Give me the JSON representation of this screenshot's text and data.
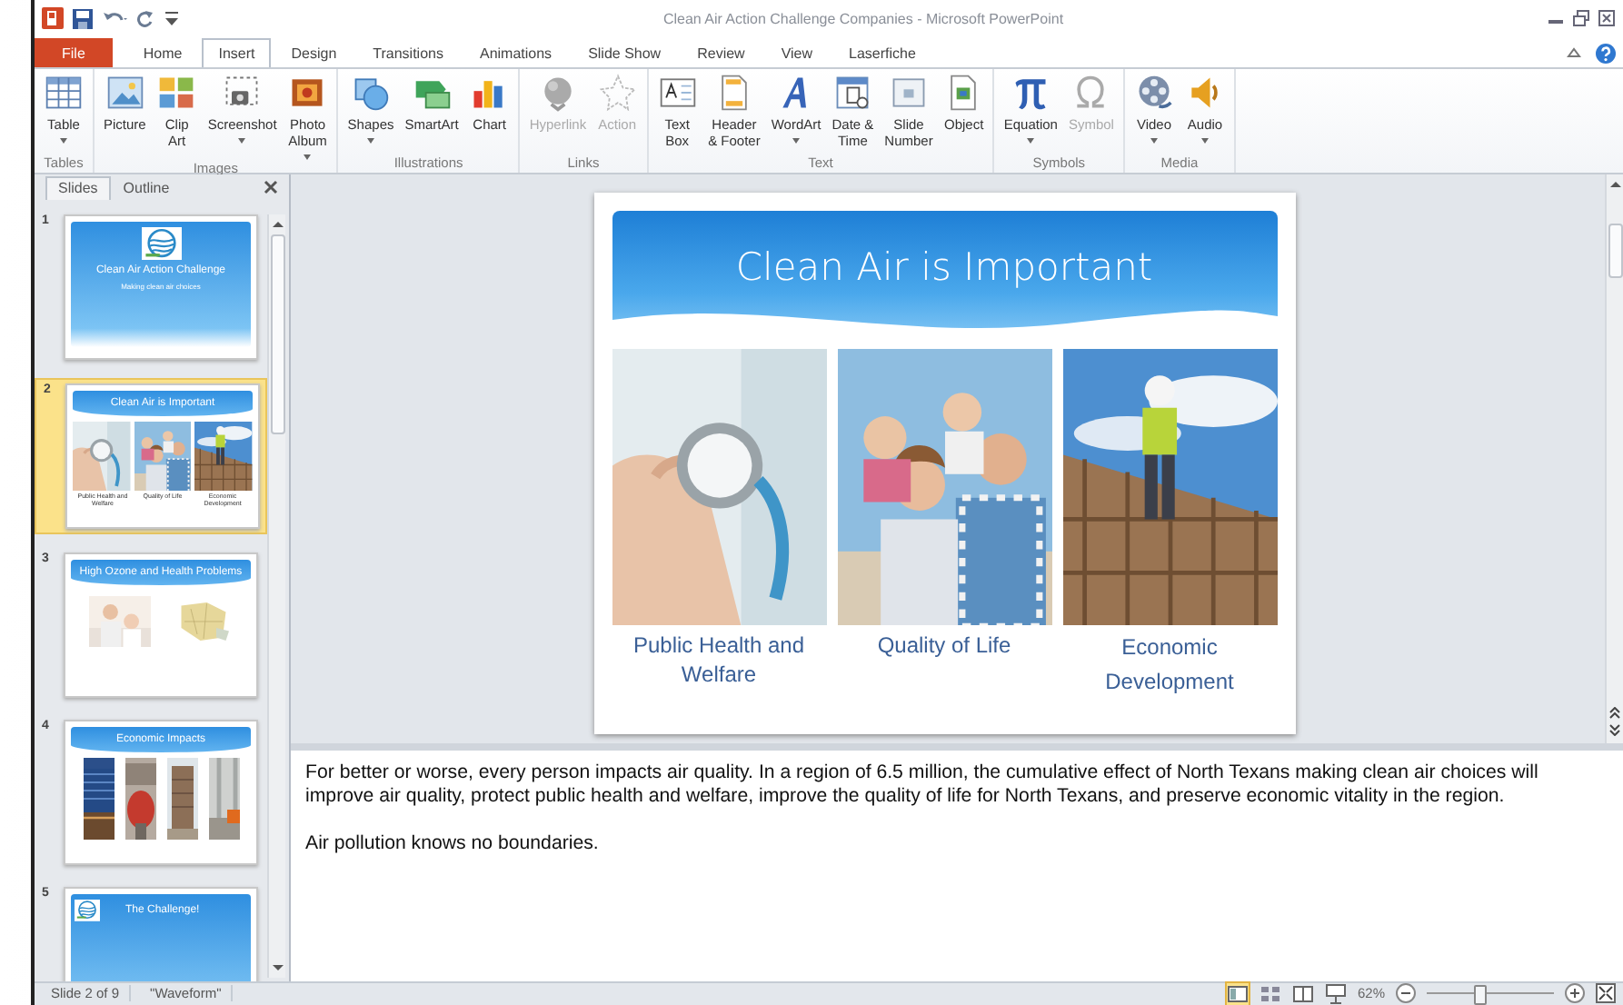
{
  "window": {
    "title": "Clean Air Action Challenge Companies - Microsoft PowerPoint"
  },
  "tabs": [
    {
      "label": "File",
      "kind": "file",
      "selected": false
    },
    {
      "label": "Home",
      "kind": "tab",
      "selected": false
    },
    {
      "label": "Insert",
      "kind": "tab",
      "selected": true
    },
    {
      "label": "Design",
      "kind": "tab",
      "selected": false
    },
    {
      "label": "Transitions",
      "kind": "tab",
      "selected": false
    },
    {
      "label": "Animations",
      "kind": "tab",
      "selected": false
    },
    {
      "label": "Slide Show",
      "kind": "tab",
      "selected": false
    },
    {
      "label": "Review",
      "kind": "tab",
      "selected": false
    },
    {
      "label": "View",
      "kind": "tab",
      "selected": false
    },
    {
      "label": "Laserfiche",
      "kind": "tab",
      "selected": false
    }
  ],
  "ribbon": {
    "groups": [
      {
        "label": "Tables",
        "commands": [
          {
            "label": "Table",
            "dropdown": true,
            "disabled": false
          }
        ]
      },
      {
        "label": "Images",
        "commands": [
          {
            "label": "Picture",
            "dropdown": false,
            "disabled": false
          },
          {
            "label": "Clip\nArt",
            "dropdown": false,
            "disabled": false
          },
          {
            "label": "Screenshot",
            "dropdown": true,
            "disabled": false
          },
          {
            "label": "Photo\nAlbum",
            "dropdown": true,
            "disabled": false
          }
        ]
      },
      {
        "label": "Illustrations",
        "commands": [
          {
            "label": "Shapes",
            "dropdown": true,
            "disabled": false
          },
          {
            "label": "SmartArt",
            "dropdown": false,
            "disabled": false
          },
          {
            "label": "Chart",
            "dropdown": false,
            "disabled": false
          }
        ]
      },
      {
        "label": "Links",
        "commands": [
          {
            "label": "Hyperlink",
            "dropdown": false,
            "disabled": true
          },
          {
            "label": "Action",
            "dropdown": false,
            "disabled": true
          }
        ]
      },
      {
        "label": "Text",
        "commands": [
          {
            "label": "Text\nBox",
            "dropdown": false,
            "disabled": false
          },
          {
            "label": "Header\n& Footer",
            "dropdown": false,
            "disabled": false
          },
          {
            "label": "WordArt",
            "dropdown": true,
            "disabled": false
          },
          {
            "label": "Date &\nTime",
            "dropdown": false,
            "disabled": false
          },
          {
            "label": "Slide\nNumber",
            "dropdown": false,
            "disabled": false
          },
          {
            "label": "Object",
            "dropdown": false,
            "disabled": false
          }
        ]
      },
      {
        "label": "Symbols",
        "commands": [
          {
            "label": "Equation",
            "dropdown": true,
            "disabled": false
          },
          {
            "label": "Symbol",
            "dropdown": false,
            "disabled": true
          }
        ]
      },
      {
        "label": "Media",
        "commands": [
          {
            "label": "Video",
            "dropdown": true,
            "disabled": false
          },
          {
            "label": "Audio",
            "dropdown": true,
            "disabled": false
          }
        ]
      }
    ]
  },
  "pane_tabs": [
    {
      "label": "Slides",
      "selected": true
    },
    {
      "label": "Outline",
      "selected": false
    }
  ],
  "thumbnails": [
    {
      "number": "1",
      "selected": false,
      "kind": "title",
      "title": "Clean Air Action Challenge",
      "subtitle": "Making clean air choices"
    },
    {
      "number": "2",
      "selected": true,
      "kind": "pictures",
      "title": "Clean Air is Important",
      "pictures": [
        {
          "kind": "picture"
        },
        {
          "kind": "picture"
        },
        {
          "kind": "picture"
        }
      ],
      "captions": [
        "Public Health and Welfare",
        "Quality of Life",
        "Economic Development"
      ]
    },
    {
      "number": "3",
      "selected": false,
      "kind": "pictures",
      "title": "High Ozone and Health Problems",
      "pictures": [
        {
          "kind": "picture"
        },
        {
          "kind": "picture"
        }
      ]
    },
    {
      "number": "4",
      "selected": false,
      "kind": "pictures",
      "title": "Economic Impacts",
      "pictures": [
        {
          "kind": "picture"
        },
        {
          "kind": "picture"
        },
        {
          "kind": "picture"
        },
        {
          "kind": "picture"
        }
      ]
    },
    {
      "number": "5",
      "selected": false,
      "kind": "logo",
      "title": "The Challenge!"
    }
  ],
  "slide": {
    "title": "Clean Air is Important",
    "pictures": [
      {
        "kind": "picture"
      },
      {
        "kind": "picture"
      },
      {
        "kind": "picture"
      }
    ],
    "captions": [
      "Public Health and\nWelfare",
      "Quality of Life",
      "Economic\nDevelopment"
    ]
  },
  "notes": [
    "For better or worse, every person impacts air quality. In a region of 6.5 million, the cumulative effect of North Texans making clean air choices will improve air quality, protect public health and welfare, improve the quality of life for North Texans, and preserve economic vitality in the region.",
    "Air pollution knows no boundaries."
  ],
  "status_bar": {
    "slide": "Slide 2 of 9",
    "theme": "\"Waveform\"",
    "views": [
      {
        "kind": "normal",
        "selected": true
      },
      {
        "kind": "sorter",
        "selected": false
      },
      {
        "kind": "reading",
        "selected": false
      },
      {
        "kind": "slideshow",
        "selected": false
      }
    ],
    "zoom": "62%",
    "zoom_slider": {
      "level": 0.42
    }
  }
}
